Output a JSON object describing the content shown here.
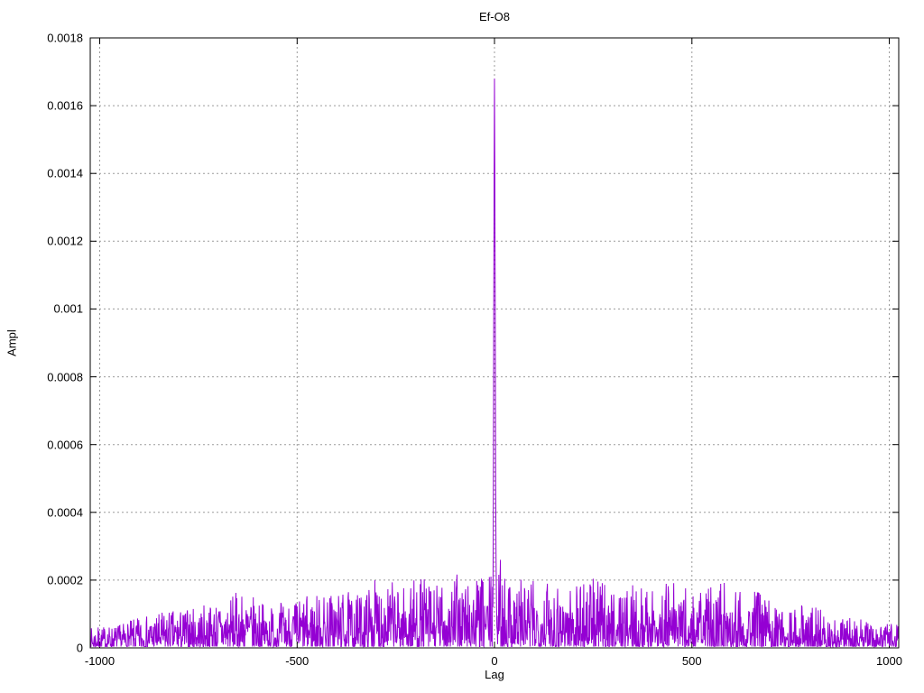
{
  "chart_data": {
    "type": "line",
    "title": "Ef-O8",
    "xlabel": "Lag",
    "ylabel": "Ampl",
    "xlim": [
      -1024,
      1024
    ],
    "ylim": [
      0,
      0.0018
    ],
    "grid": true,
    "legend": "none",
    "line_color": "#9400d3",
    "grid_color": "#9b9b9b",
    "axis_color": "#000000",
    "xticks": [
      -1000,
      -500,
      0,
      500,
      1000
    ],
    "xtick_labels": [
      "-1000",
      "-500",
      "0",
      "500",
      "1000"
    ],
    "yticks": [
      0,
      0.0002,
      0.0004,
      0.0006,
      0.0008,
      0.001,
      0.0012,
      0.0014,
      0.0016,
      0.0018
    ],
    "ytick_labels": [
      "0",
      "0.0002",
      "0.0004",
      "0.0006",
      "0.0008",
      "0.001",
      "0.0012",
      "0.0014",
      "0.0016",
      "0.0018"
    ],
    "peak_points": [
      [
        -5,
        0.00018
      ],
      [
        -4,
        0.00012
      ],
      [
        -3,
        0.00035
      ],
      [
        -2,
        0.00095
      ],
      [
        -1,
        0.00137
      ],
      [
        0,
        0.00168
      ],
      [
        1,
        0.00137
      ],
      [
        2,
        0.00095
      ],
      [
        3,
        0.00048
      ],
      [
        4,
        0.00026
      ],
      [
        5,
        0.00015
      ],
      [
        15,
        0.00026
      ]
    ],
    "noise": {
      "seed": 7,
      "step": 1,
      "shape_power": 1.9,
      "floor": 4e-06,
      "envelope": [
        [
          -1024,
          6e-05
        ],
        [
          -950,
          7e-05
        ],
        [
          -900,
          9e-05
        ],
        [
          -830,
          0.00011
        ],
        [
          -760,
          0.00012
        ],
        [
          -700,
          0.00014
        ],
        [
          -640,
          0.00017
        ],
        [
          -580,
          0.00013
        ],
        [
          -520,
          0.00014
        ],
        [
          -460,
          0.00016
        ],
        [
          -400,
          0.00017
        ],
        [
          -340,
          0.00016
        ],
        [
          -290,
          0.00022
        ],
        [
          -240,
          0.00018
        ],
        [
          -190,
          0.00021
        ],
        [
          -140,
          0.00019
        ],
        [
          -90,
          0.00022
        ],
        [
          -40,
          0.00021
        ],
        [
          0,
          0.00022
        ],
        [
          40,
          0.00023
        ],
        [
          90,
          0.0002
        ],
        [
          140,
          0.00022
        ],
        [
          190,
          0.00019
        ],
        [
          240,
          0.00022
        ],
        [
          290,
          0.00018
        ],
        [
          340,
          0.00019
        ],
        [
          400,
          0.00017
        ],
        [
          450,
          0.00021
        ],
        [
          500,
          0.00016
        ],
        [
          550,
          0.00018
        ],
        [
          600,
          0.00021
        ],
        [
          650,
          0.00018
        ],
        [
          700,
          0.00014
        ],
        [
          750,
          0.00012
        ],
        [
          800,
          0.00013
        ],
        [
          850,
          0.0001
        ],
        [
          900,
          9e-05
        ],
        [
          950,
          8e-05
        ],
        [
          1024,
          7e-05
        ]
      ]
    }
  }
}
